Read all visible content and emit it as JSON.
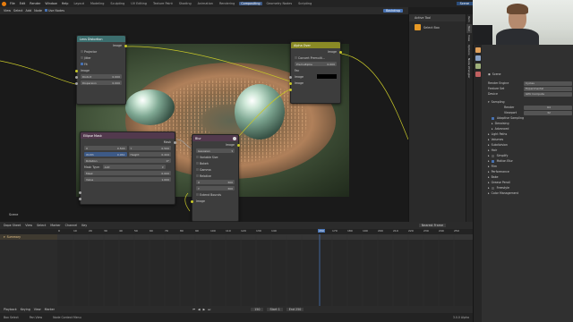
{
  "topbar": {
    "menus": [
      "File",
      "Edit",
      "Render",
      "Window",
      "Help"
    ],
    "workspaces": [
      "Layout",
      "Modeling",
      "Sculpting",
      "UV Editing",
      "Texture Paint",
      "Shading",
      "Animation",
      "Rendering",
      "Compositing",
      "Geometry Nodes",
      "Scripting"
    ],
    "active_workspace": "Compositing",
    "scene": "Scene"
  },
  "node_header": {
    "items": [
      "View",
      "Select",
      "Add",
      "Node"
    ],
    "use_nodes": "Use Nodes",
    "backdrop_label": "Backdrop"
  },
  "lens_distortion": {
    "title": "Lens Distortion",
    "output": "Image",
    "projector": "Projector",
    "jitter": "Jitter",
    "fit": "Fit",
    "input": "Image",
    "distort_label": "Distort",
    "distort_value": "0.000",
    "dispersion_label": "Dispersion",
    "dispersion_value": "0.000"
  },
  "alpha_over": {
    "title": "Alpha Over",
    "output": "Image",
    "convert": "Convert Premulti...",
    "premult_label": "Premultiplie",
    "premult_value": "0.000",
    "fac": "Fac",
    "image1": "Image",
    "image2": "Image"
  },
  "ellipse_mask": {
    "title": "Ellipse Mask",
    "output": "Mask",
    "x_label": "X",
    "x_value": "0.500",
    "y_label": "Y",
    "y_value": "0.500",
    "width_label": "Width",
    "width_value": "0.961",
    "height_label": "Height",
    "height_value": "0.444",
    "rotation_label": "Rotation",
    "rotation_value": "0°",
    "mask_type_label": "Mask Type:",
    "mask_type_value": "Add",
    "mask_label": "Mask",
    "mask_value": "0.000",
    "value_label": "Value",
    "value_value": "1.000"
  },
  "blur": {
    "title": "Blur",
    "output": "Image",
    "filter": "Gaussian",
    "variable_size": "Variable Size",
    "bokeh": "Bokeh",
    "gamma": "Gamma",
    "relative": "Relative",
    "x_label": "X",
    "x_value": "300",
    "y_label": "Y",
    "y_value": "300",
    "extend_bounds": "Extend Bounds",
    "input": "Image"
  },
  "viewer_label": "Scene",
  "sidebar": {
    "tab_title": "Active Tool",
    "tool": "Select Box",
    "tabs": [
      "Item",
      "Tool",
      "View",
      "Options",
      "Node Wrangler"
    ]
  },
  "properties": {
    "scene": "Scene",
    "render_engine_label": "Render Engine",
    "render_engine": "Cycles",
    "feature_set_label": "Feature Set",
    "feature_set": "Experimental",
    "device_label": "Device",
    "device": "GPU Compute",
    "sampling": "Sampling",
    "render_label": "Render",
    "render_value": "64",
    "viewport_label": "Viewport",
    "viewport_value": "32",
    "adaptive": "Adaptive Sampling",
    "denoising": "Denoising",
    "advanced": "Advanced",
    "sections": [
      "Light Paths",
      "Volumes",
      "Subdivision",
      "Hair",
      "Simplify",
      "Motion Blur",
      "Film",
      "Performance",
      "Bake",
      "Grease Pencil",
      "Freestyle",
      "Color Management"
    ],
    "motion_blur_checked": true
  },
  "timeline": {
    "menus": [
      "Dope Sheet",
      "View",
      "Select",
      "Marker",
      "Channel",
      "Key"
    ],
    "summary": "Summary",
    "mode": "Nearest Frame",
    "frames": [
      "0",
      "10",
      "20",
      "30",
      "40",
      "50",
      "60",
      "70",
      "80",
      "90",
      "100",
      "110",
      "120",
      "130",
      "140",
      "150",
      "160",
      "170",
      "180",
      "190",
      "200",
      "210",
      "220",
      "230",
      "240",
      "250"
    ],
    "current_frame": "150"
  },
  "playback": {
    "items": [
      "Playback",
      "Keying",
      "View",
      "Marker"
    ],
    "current": "150",
    "start_label": "Start",
    "start": "1",
    "end_label": "End",
    "end": "250"
  },
  "statusbar": {
    "items": [
      "Box Select",
      "Pan View",
      "Node Context Menu"
    ],
    "version": "3.0.0 Alpha"
  },
  "colors": {
    "accent": "#4772b3",
    "node_header_green": "#3c6e6e",
    "node_header_yellow": "#8a8a25",
    "node_header_purple": "#52394d",
    "frame_marker": "#4772b3"
  }
}
